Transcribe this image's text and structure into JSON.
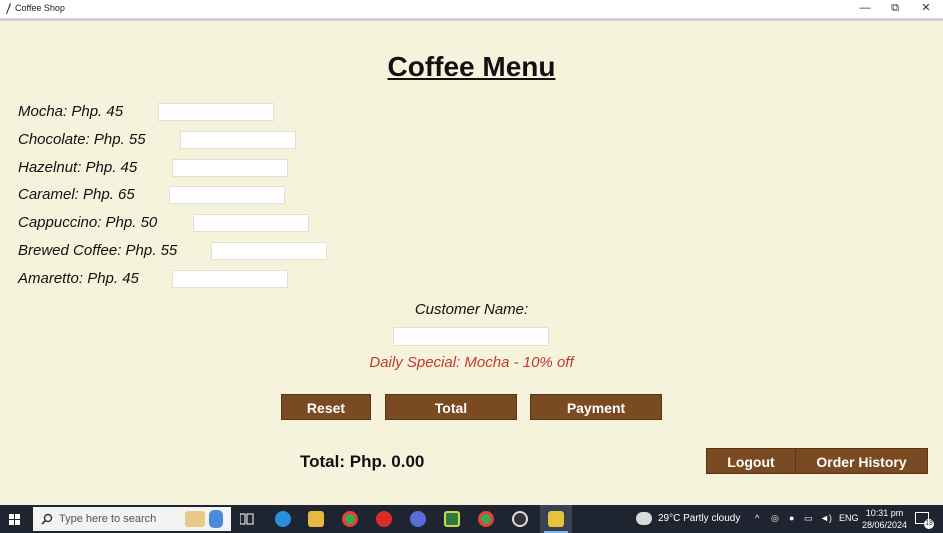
{
  "window": {
    "title": "Coffee Shop",
    "minimize": "—",
    "restore": "⧉",
    "close": "✕"
  },
  "menu": {
    "heading": "Coffee Menu",
    "items": [
      {
        "label": "Mocha: Php. 45",
        "value": ""
      },
      {
        "label": "Chocolate: Php. 55",
        "value": ""
      },
      {
        "label": "Hazelnut: Php. 45",
        "value": ""
      },
      {
        "label": "Caramel: Php. 65",
        "value": ""
      },
      {
        "label": "Cappuccino: Php. 50",
        "value": ""
      },
      {
        "label": "Brewed Coffee: Php. 55",
        "value": ""
      },
      {
        "label": "Amaretto: Php. 45",
        "value": ""
      }
    ],
    "customer_label": "Customer Name:",
    "customer_value": "",
    "daily_special": "Daily Special: Mocha - 10% off",
    "buttons": {
      "reset": "Reset",
      "total": "Total",
      "payment": "Payment",
      "logout": "Logout",
      "order_history": "Order History"
    },
    "total_text": "Total: Php. 0.00"
  },
  "taskbar": {
    "search_placeholder": "Type here to search",
    "weather": "29°C  Partly cloudy",
    "language": "ENG",
    "time": "10:31 pm",
    "date": "28/06/2024",
    "notification_count": "18"
  },
  "colors": {
    "background": "#f6f3dd",
    "button": "#7a4a22",
    "special_text": "#c6372f"
  }
}
